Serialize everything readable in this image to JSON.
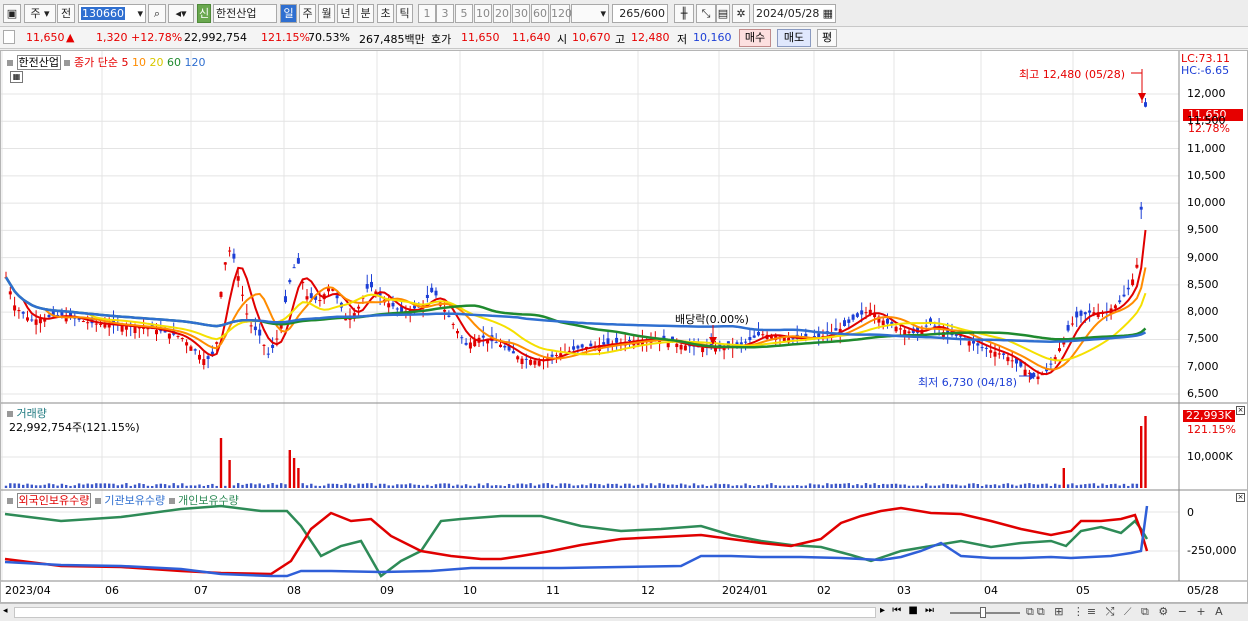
{
  "toolbar": {
    "market_select": "주",
    "ref_button": "전",
    "code_value": "130660",
    "stock_name_badge": "신",
    "stock_name": "한전산업",
    "periods": [
      "일",
      "주",
      "월",
      "년",
      "분",
      "초",
      "틱"
    ],
    "numbers": [
      "1",
      "3",
      "5",
      "10",
      "20",
      "30",
      "60",
      "120"
    ],
    "count_value": "265",
    "count_max": "/600",
    "date_value": "2024/05/28"
  },
  "quote": {
    "price": "11,650",
    "arrow": "▲",
    "change": "1,320",
    "change_pct": "+12.78%",
    "volume": "22,992,754",
    "volume_pct": "121.15%",
    "ratio": "70.53%",
    "amount": "267,485백만",
    "hoga_label": "호가",
    "hoga_ask": "11,650",
    "hoga_bid": "11,640",
    "open_label": "시",
    "open": "10,670",
    "high_label": "고",
    "high": "12,480",
    "low_label": "저",
    "low": "10,160",
    "buy_button": "매수",
    "sell_button": "매도",
    "eval_button": "평"
  },
  "legend": {
    "name": "한전산업",
    "close_label": "종가 단순",
    "ma": [
      "5",
      "10",
      "20",
      "60",
      "120"
    ],
    "ma_colors": [
      "#e00000",
      "#ff8c00",
      "#f5e000",
      "#1f8a2e",
      "#2f6fd0"
    ]
  },
  "annotations": {
    "high_text": "최고 12,480 (05/28)",
    "low_text": "최저 6,730 (04/18)",
    "dividend_text": "배당락(0.00%)"
  },
  "price_axis": {
    "ticks": [
      "12,000",
      "11,500",
      "11,000",
      "10,500",
      "10,000",
      "9,500",
      "9,000",
      "8,500",
      "8,000",
      "7,500",
      "7,000",
      "6,500"
    ],
    "lc": "LC:73.11",
    "hc": "HC:-6.65",
    "current_label": "11,650",
    "current_pct": "12.78%"
  },
  "volume_panel": {
    "title": "거래량",
    "value_text": "22,992,754주(121.15%)",
    "axis_tick": "10,000K",
    "current_label": "22,993K",
    "current_pct": "121.15%"
  },
  "holdings_panel": {
    "foreign_label": "외국인보유수량",
    "inst_label": "기관보유수량",
    "indiv_label": "개인보유수량",
    "axis_ticks": [
      "0",
      "-250,000"
    ]
  },
  "x_axis": {
    "labels": [
      "2023/04",
      "06",
      "07",
      "08",
      "09",
      "10",
      "11",
      "12",
      "2024/01",
      "02",
      "03",
      "04",
      "05",
      "05/28"
    ]
  },
  "chart_data": {
    "type": "candlestick",
    "last_close": 11650,
    "high": 12480,
    "high_date": "05/28",
    "low": 6730,
    "low_date": "04/18",
    "ylim": [
      6500,
      12000
    ],
    "volume_last": 22992754
  }
}
